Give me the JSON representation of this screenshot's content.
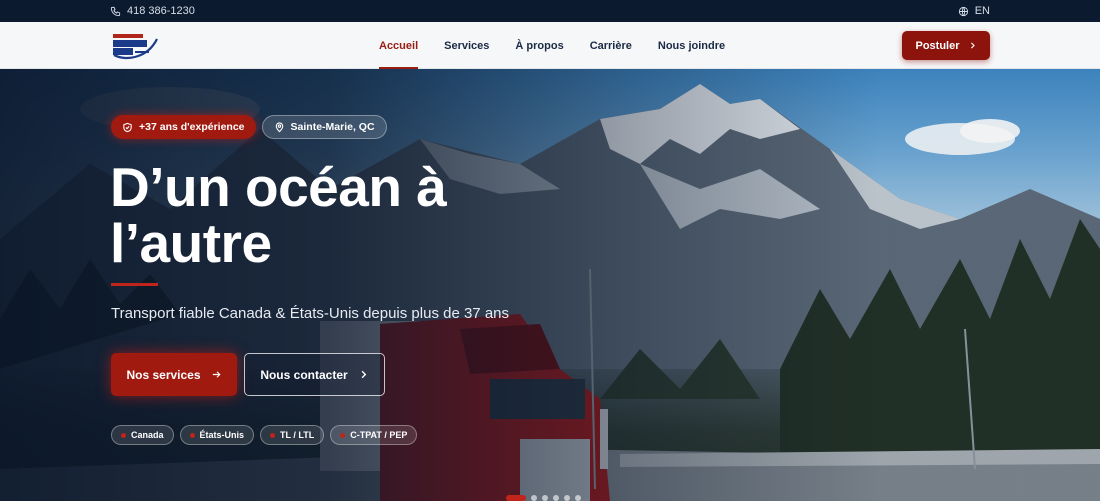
{
  "topbar": {
    "phone": "418 386-1230",
    "language": "EN"
  },
  "nav": {
    "items": [
      {
        "label": "Accueil",
        "active": true
      },
      {
        "label": "Services",
        "active": false
      },
      {
        "label": "À propos",
        "active": false
      },
      {
        "label": "Carrière",
        "active": false
      },
      {
        "label": "Nous joindre",
        "active": false
      }
    ],
    "cta_label": "Postuler"
  },
  "hero": {
    "badge_experience": "+37 ans d'expérience",
    "badge_location": "Sainte-Marie, QC",
    "title_line1": "D’un océan à",
    "title_line2": "l’autre",
    "subtitle": "Transport fiable Canada & États-Unis depuis plus de 37 ans",
    "primary_button": "Nos services",
    "secondary_button": "Nous contacter",
    "chips": [
      "Canada",
      "États-Unis",
      "TL / LTL",
      "C-TPAT / PEP"
    ],
    "slide_count": 6,
    "active_slide": 1
  },
  "colors": {
    "brand_red": "#8c140c",
    "navy": "#0c1a30",
    "accent_red": "#c0241a"
  }
}
